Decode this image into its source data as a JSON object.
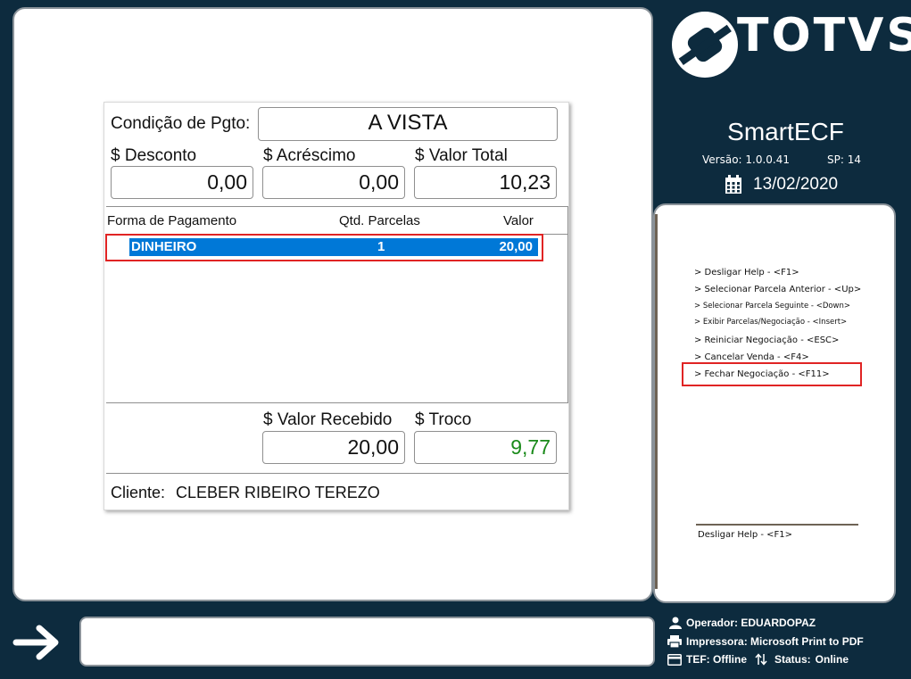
{
  "brand": {
    "logo_text": "TOTVS",
    "app_name": "SmartECF",
    "version_label": "Versão: 1.0.0.41",
    "sp_label": "SP: 14",
    "date": "13/02/2020"
  },
  "payment": {
    "condition_label": "Condição de Pgto:",
    "condition_value": "A VISTA",
    "discount_label": "$ Desconto",
    "discount_value": "0,00",
    "surcharge_label": "$ Acréscimo",
    "surcharge_value": "0,00",
    "total_label": "$ Valor Total",
    "total_value": "10,23",
    "columns": [
      "Forma de Pagamento",
      "Qtd. Parcelas",
      "Valor"
    ],
    "rows": [
      {
        "method": "DINHEIRO",
        "installments": "1",
        "value": "20,00"
      }
    ],
    "received_label": "$ Valor Recebido",
    "received_value": "20,00",
    "change_label": "$ Troco",
    "change_value": "9,77",
    "client_label": "Cliente:",
    "client_value": "CLEBER RIBEIRO TEREZO"
  },
  "help": {
    "items": [
      "> Desligar Help - <F1>",
      "> Selecionar Parcela Anterior - <Up>",
      "> Selecionar Parcela Seguinte - <Down>",
      "> Exibir Parcelas/Negociação - <Insert>",
      "> Reiniciar Negociação - <ESC>",
      "> Cancelar Venda - <F4>",
      "> Fechar Negociação - <F11>"
    ],
    "footer": "Desligar Help - <F1>"
  },
  "status": {
    "operator": "Operador: EDUARDOPAZ",
    "printer": "Impressora: Microsoft Print to PDF",
    "tef": "TEF: Offline",
    "status_label": "Status:",
    "status_value": "Online"
  },
  "colors": {
    "background": "#0d2b3e",
    "selection": "#0078d7",
    "change_value": "#1a8a1a",
    "highlight_border": "#e02424"
  },
  "icons": [
    "totvs-logo-icon",
    "calendar-icon",
    "arrow-right-icon",
    "user-icon",
    "printer-icon",
    "card-icon",
    "sync-icon"
  ]
}
